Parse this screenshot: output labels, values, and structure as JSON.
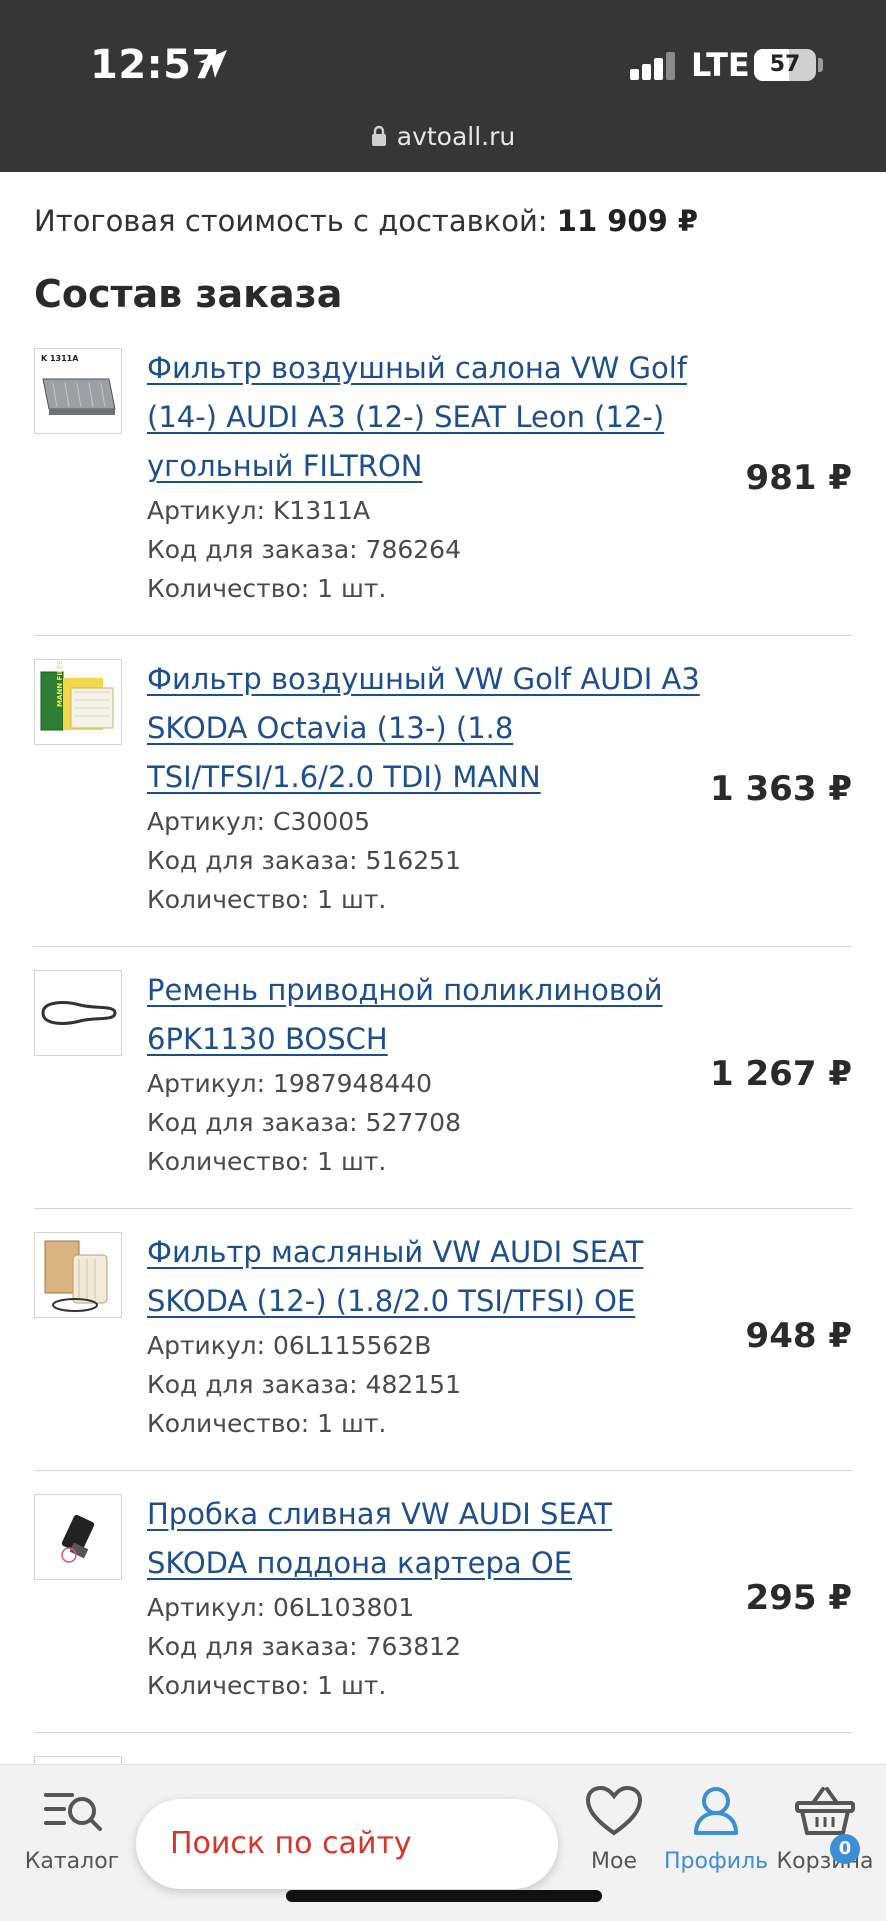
{
  "status_bar": {
    "time": "12:57",
    "network": "LTE",
    "battery_percent": "57",
    "battery_level": 0.57,
    "url": "avtoall.ru"
  },
  "summary": {
    "label": "Итоговая стоимость с доставкой:",
    "value": "11 909 ₽"
  },
  "section_title": "Состав заказа",
  "items": [
    {
      "title": "Фильтр воздушный салона VW Golf (14-) AUDI A3 (12-) SEAT Leon (12-) угольный FILTRON",
      "article": "Артикул: K1311A",
      "order_code": "Код для заказа: 786264",
      "quantity": "Количество: 1 шт.",
      "price": "981 ₽",
      "thumb_label": "K 1311A",
      "thumb_icon": "cabin-filter-image"
    },
    {
      "title": "Фильтр воздушный VW Golf AUDI A3 SKODA Octavia (13-) (1.8 TSI/TFSI/1.6/2.0 TDI) MANN",
      "article": "Артикул: C30005",
      "order_code": "Код для заказа: 516251",
      "quantity": "Количество: 1 шт.",
      "price": "1 363 ₽",
      "thumb_label": "MANN FILTER",
      "thumb_icon": "air-filter-box-image"
    },
    {
      "title": "Ремень приводной поликлиновой 6PK1130 BOSCH",
      "article": "Артикул: 1987948440",
      "order_code": "Код для заказа: 527708",
      "quantity": "Количество: 1 шт.",
      "price": "1 267 ₽",
      "thumb_icon": "belt-image"
    },
    {
      "title": "Фильтр масляный VW AUDI SEAT SKODA (12-) (1.8/2.0 TSI/TFSI) OE",
      "article": "Артикул: 06L115562B",
      "order_code": "Код для заказа: 482151",
      "quantity": "Количество: 1 шт.",
      "price": "948 ₽",
      "thumb_icon": "oil-filter-image"
    },
    {
      "title": "Пробка сливная VW AUDI SEAT SKODA поддона картера OE",
      "article": "Артикул: 06L103801",
      "order_code": "Код для заказа: 763812",
      "quantity": "Количество: 1 шт.",
      "price": "295 ₽",
      "thumb_icon": "drain-plug-image"
    }
  ],
  "bottom_nav": {
    "catalog": "Каталог",
    "search_placeholder": "Поиск по сайту",
    "mine": "Мое",
    "profile": "Профиль",
    "cart": "Корзина",
    "cart_count": "0"
  },
  "colors": {
    "link": "#1d4f8f",
    "accent": "#3a8fd6",
    "search_text": "#d9342b",
    "statusbar": "#363636"
  }
}
